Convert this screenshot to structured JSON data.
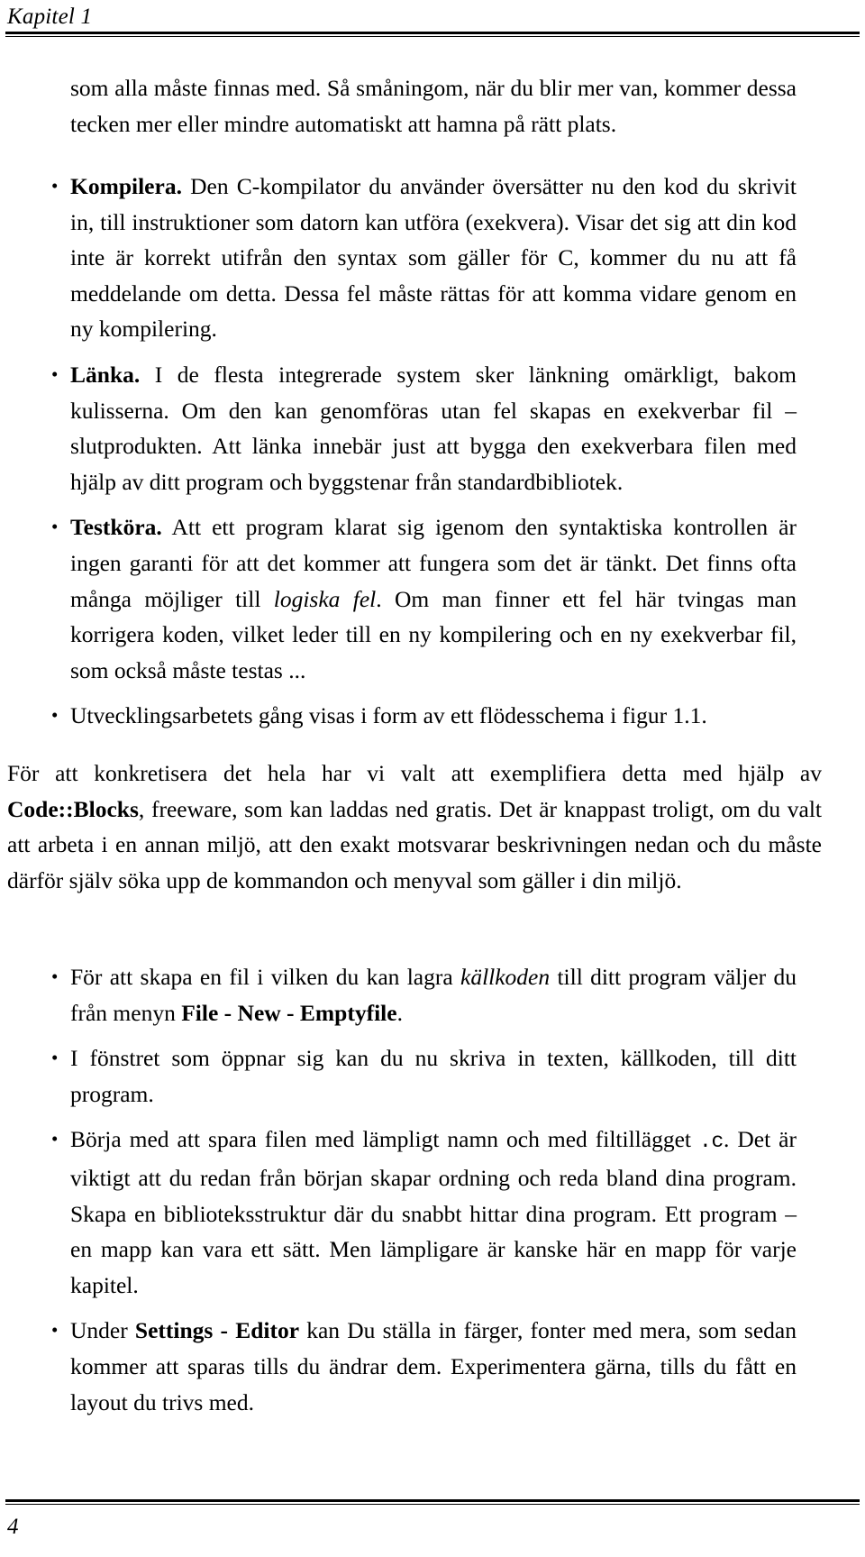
{
  "header": {
    "chapter_label": "Kapitel 1"
  },
  "footer": {
    "page_number": "4"
  },
  "content": {
    "continued_paragraph": "som alla måste finnas med. Så småningom, när du blir mer van, kommer dessa tecken mer eller mindre automatiskt att hamna på rätt plats.",
    "list_one": {
      "bullet_glyph": "•",
      "items": [
        {
          "lead": "Kompilera.",
          "rest": " Den C-kompilator du använder översätter nu den kod du skrivit in, till instruktioner som datorn kan utföra (exekvera). Visar det sig att din kod inte är korrekt utifrån den syntax som gäller för C, kommer du nu att få meddelande om detta. Dessa fel måste rättas för att komma vidare genom en ny kompilering."
        },
        {
          "lead": "Länka.",
          "rest": " I de flesta integrerade system sker länkning omärkligt, bakom kulisserna. Om den kan genomföras utan fel skapas en exekverbar fil – slutprodukten. Att länka innebär just att bygga den exekverbara filen med hjälp av ditt program och byggstenar från standardbibliotek."
        },
        {
          "lead": "Testköra.",
          "rest_a": " Att ett program klarat sig igenom den syntaktiska kontrollen är ingen garanti för att det kommer att fungera som det är tänkt. Det finns ofta många möjliger till ",
          "emphasis": "logiska fel",
          "rest_b": ". Om man finner ett fel här tvingas man korrigera koden, vilket leder till en ny kompilering och en ny exekverbar fil, som också måste testas ..."
        },
        {
          "text": "Utvecklingsarbetets gång visas i form av ett flödesschema i figur 1.1."
        }
      ]
    },
    "paragraph_codeblocks": {
      "part_a": "För att konkretisera det hela har vi valt att exemplifiera detta med hjälp av ",
      "bold": "Code::Blocks",
      "part_b": ", freeware, som kan laddas ned gratis. Det är knappast troligt, om du valt att arbeta i en annan miljö, att den exakt motsvarar beskrivningen nedan och du måste därför själv söka upp de kommandon och menyval som gäller i din miljö."
    },
    "list_two": {
      "bullet_glyph": "•",
      "items": [
        {
          "part_a": "För att skapa en fil i vilken du kan lagra ",
          "emphasis": "källkoden",
          "part_b": " till ditt program väljer du från menyn ",
          "bold": "File - New - Emptyfile",
          "part_c": "."
        },
        {
          "text": "I fönstret som öppnar sig kan du nu skriva in texten, källkoden, till ditt program."
        },
        {
          "part_a": "Börja med att spara filen med lämpligt namn och med filtillägget ",
          "code": ".c",
          "part_b": ". Det är viktigt att du redan från början skapar ordning och reda bland dina program. Skapa en biblioteksstruktur där du snabbt hittar dina program. Ett program – en mapp kan vara ett sätt. Men lämpligare är kanske här en mapp för varje kapitel."
        },
        {
          "part_a": "Under ",
          "bold": "Settings - Editor",
          "part_b": " kan Du ställa in färger, fonter med mera, som sedan kommer att sparas tills du ändrar dem. Experimentera gärna, tills du fått en layout du trivs med."
        }
      ]
    }
  }
}
